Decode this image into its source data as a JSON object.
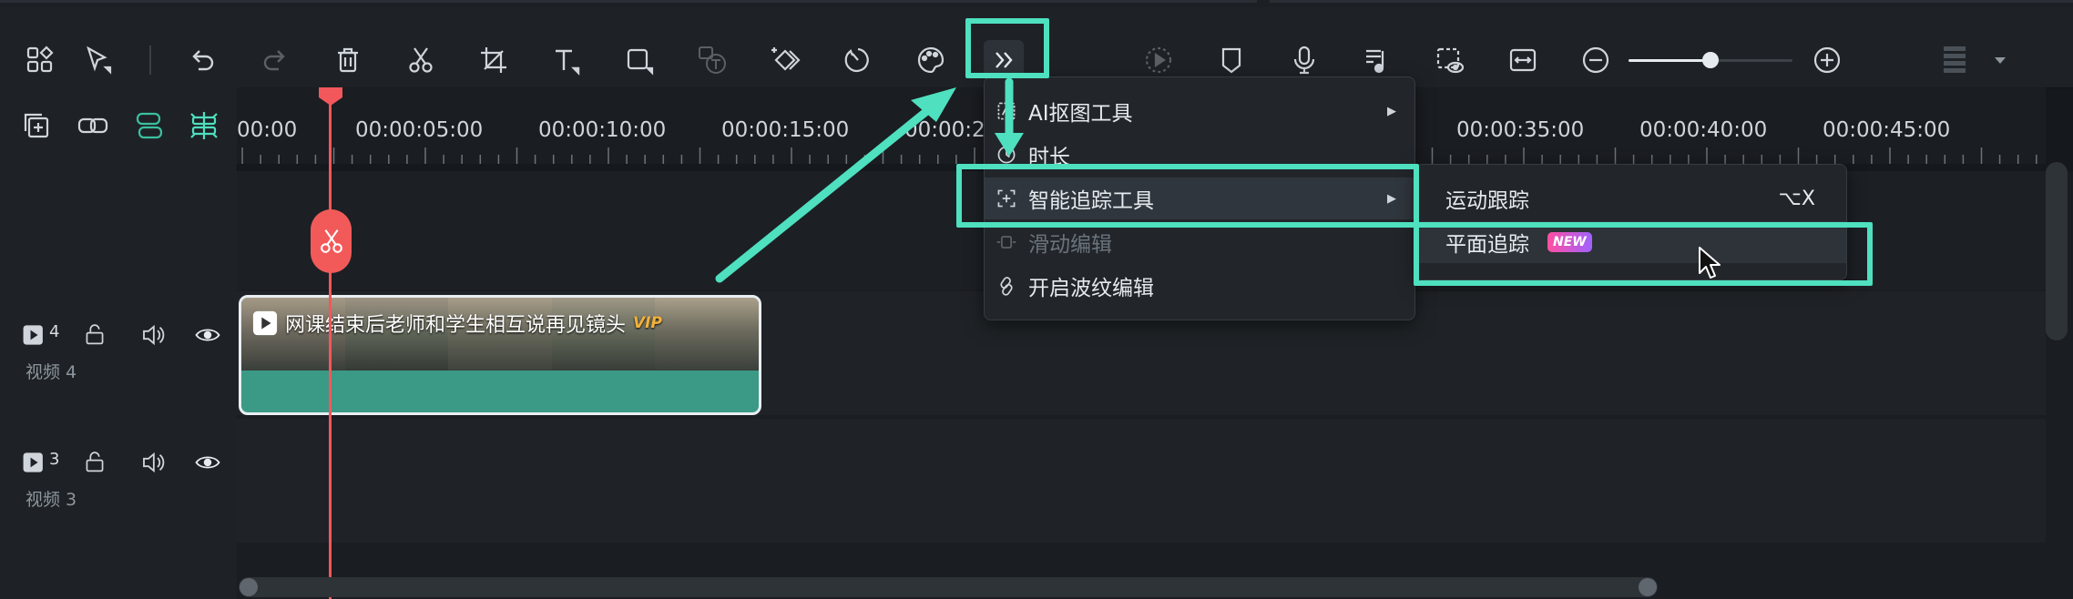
{
  "toolbar": {
    "left_tools": [
      "layout-icon",
      "select-tool-icon",
      "undo-icon",
      "redo-icon",
      "delete-icon",
      "cut-icon",
      "crop-icon",
      "text-icon",
      "shape-icon",
      "speech-to-text-icon",
      "keyframe-icon",
      "speed-icon",
      "color-icon",
      "more-tools-icon"
    ],
    "right_tools": [
      "render-preview-icon",
      "marker-icon",
      "voiceover-icon",
      "audio-ducking-icon",
      "snapshot-icon",
      "fit-icon",
      "zoom-out-icon",
      "zoom-in-icon",
      "layout-menu-icon"
    ],
    "zoom_level": 0.5
  },
  "timeline_tools": [
    "add-track-icon",
    "link-icon",
    "magnet-icon",
    "auto-snap-icon"
  ],
  "ruler": {
    "labels": [
      "00:00",
      "00:00:05:00",
      "00:00:10:00",
      "00:00:15:00",
      "00:00:2",
      "00:00:35:00",
      "00:00:40:00",
      "00:00:45:00"
    ]
  },
  "tracks": [
    {
      "number": "4",
      "label": "视频 4"
    },
    {
      "number": "3",
      "label": "视频 3"
    }
  ],
  "clip": {
    "title": "网课结束后老师和学生相互说再见镜头",
    "badge": "VIP"
  },
  "menu": {
    "items": [
      {
        "label": "AI抠图工具",
        "icon": "ai-cutout-icon",
        "has_submenu": true,
        "enabled": true
      },
      {
        "label": "时长",
        "icon": "duration-icon",
        "has_submenu": false,
        "enabled": true
      },
      {
        "label": "智能追踪工具",
        "icon": "smart-tracking-icon",
        "has_submenu": true,
        "enabled": true
      },
      {
        "label": "滑动编辑",
        "icon": "slide-edit-icon",
        "has_submenu": false,
        "enabled": false
      },
      {
        "label": "开启波纹编辑",
        "icon": "ripple-edit-icon",
        "has_submenu": false,
        "enabled": true
      }
    ]
  },
  "submenu": {
    "items": [
      {
        "label": "运动跟踪",
        "shortcut": "⌥X"
      },
      {
        "label": "平面追踪",
        "badge": "NEW"
      }
    ]
  },
  "colors": {
    "accent_highlight": "#4ee0bf",
    "playhead": "#f2575b",
    "clip_fill": "#3b9a86"
  }
}
